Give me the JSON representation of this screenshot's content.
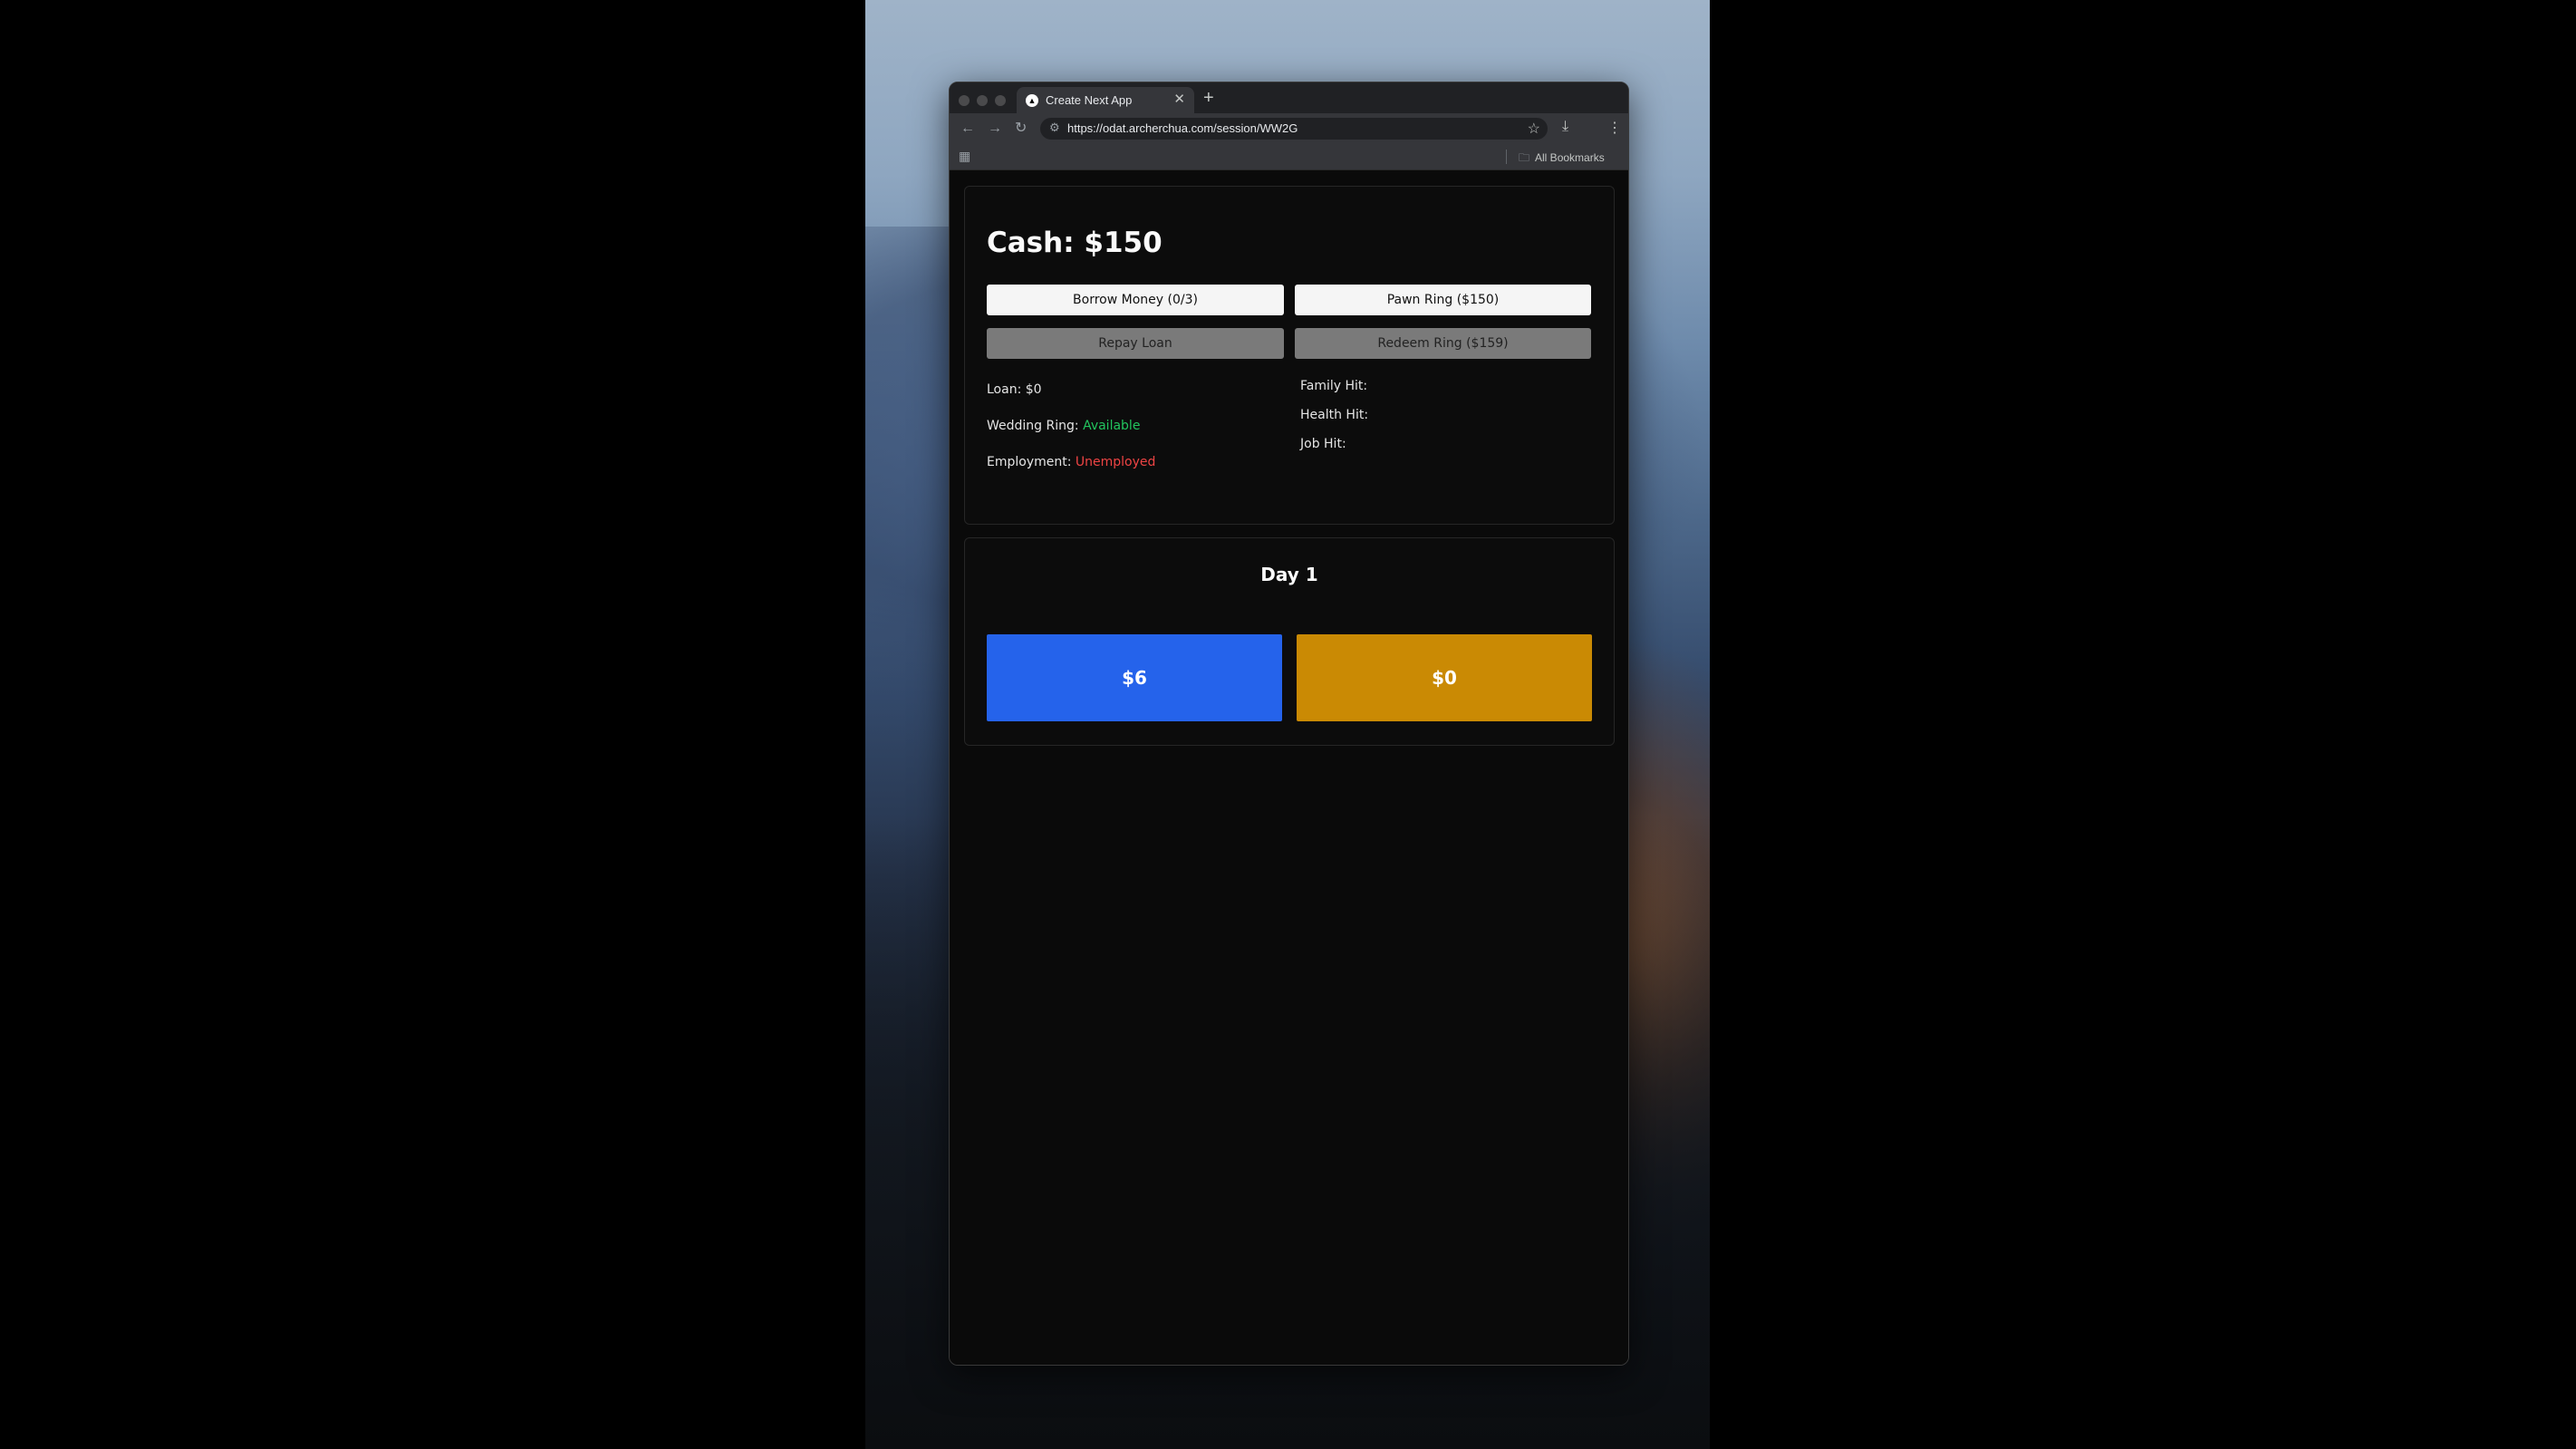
{
  "browser": {
    "tab_title": "Create Next App",
    "tab_favicon": "▲",
    "url": "https://odat.archerchua.com/session/WW2G",
    "all_bookmarks_label": "All Bookmarks"
  },
  "game": {
    "cash_text": "Cash: $150",
    "buttons": {
      "borrow": "Borrow Money (0/3)",
      "pawn": "Pawn Ring ($150)",
      "repay": "Repay Loan",
      "redeem": "Redeem Ring ($159)"
    },
    "stats": {
      "loan_text": "Loan: $0",
      "ring_label": "Wedding Ring: ",
      "ring_value": "Available",
      "employment_label": "Employment: ",
      "employment_value": "Unemployed",
      "family_hit": "Family Hit:",
      "health_hit": "Health Hit:",
      "job_hit": "Job Hit:"
    },
    "day_title": "Day 1",
    "choices": {
      "blue": "$6",
      "gold": "$0"
    }
  },
  "colors": {
    "blue_choice": "#2563eb",
    "gold_choice": "#ca8a04",
    "available": "#22c55e",
    "unemployed": "#ef4444"
  }
}
